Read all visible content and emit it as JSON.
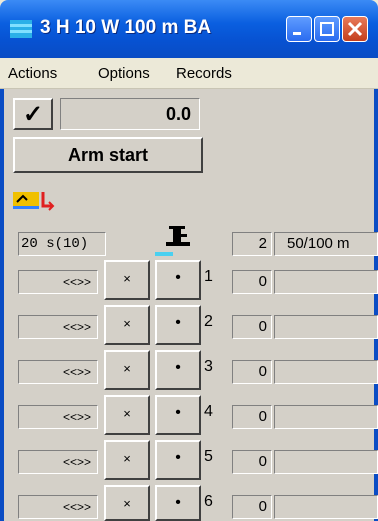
{
  "window": {
    "title": "3 H 10 W 100 m BA"
  },
  "menu": [
    "Actions",
    "Options",
    "Records"
  ],
  "timer": {
    "check_label": "✓",
    "value": "0.0"
  },
  "arm_start": {
    "label": "Arm start"
  },
  "header": {
    "interval": "20 s(10)",
    "count": "2",
    "distance": "50/100 m"
  },
  "lanes": [
    {
      "control": "<<>>",
      "x": "×",
      "dot": "•",
      "lane": "1",
      "zero": "0"
    },
    {
      "control": "<<>>",
      "x": "×",
      "dot": "•",
      "lane": "2",
      "zero": "0"
    },
    {
      "control": "<<>>",
      "x": "×",
      "dot": "•",
      "lane": "3",
      "zero": "0"
    },
    {
      "control": "<<>>",
      "x": "×",
      "dot": "•",
      "lane": "4",
      "zero": "0"
    },
    {
      "control": "<<>>",
      "x": "×",
      "dot": "•",
      "lane": "5",
      "zero": "0"
    },
    {
      "control": "<<>>",
      "x": "×",
      "dot": "•",
      "lane": "6",
      "zero": "0"
    }
  ],
  "colors": {
    "titlebar": "#0a5fe0",
    "client": "#d4d0c8",
    "accent": "#4ad0f0"
  }
}
